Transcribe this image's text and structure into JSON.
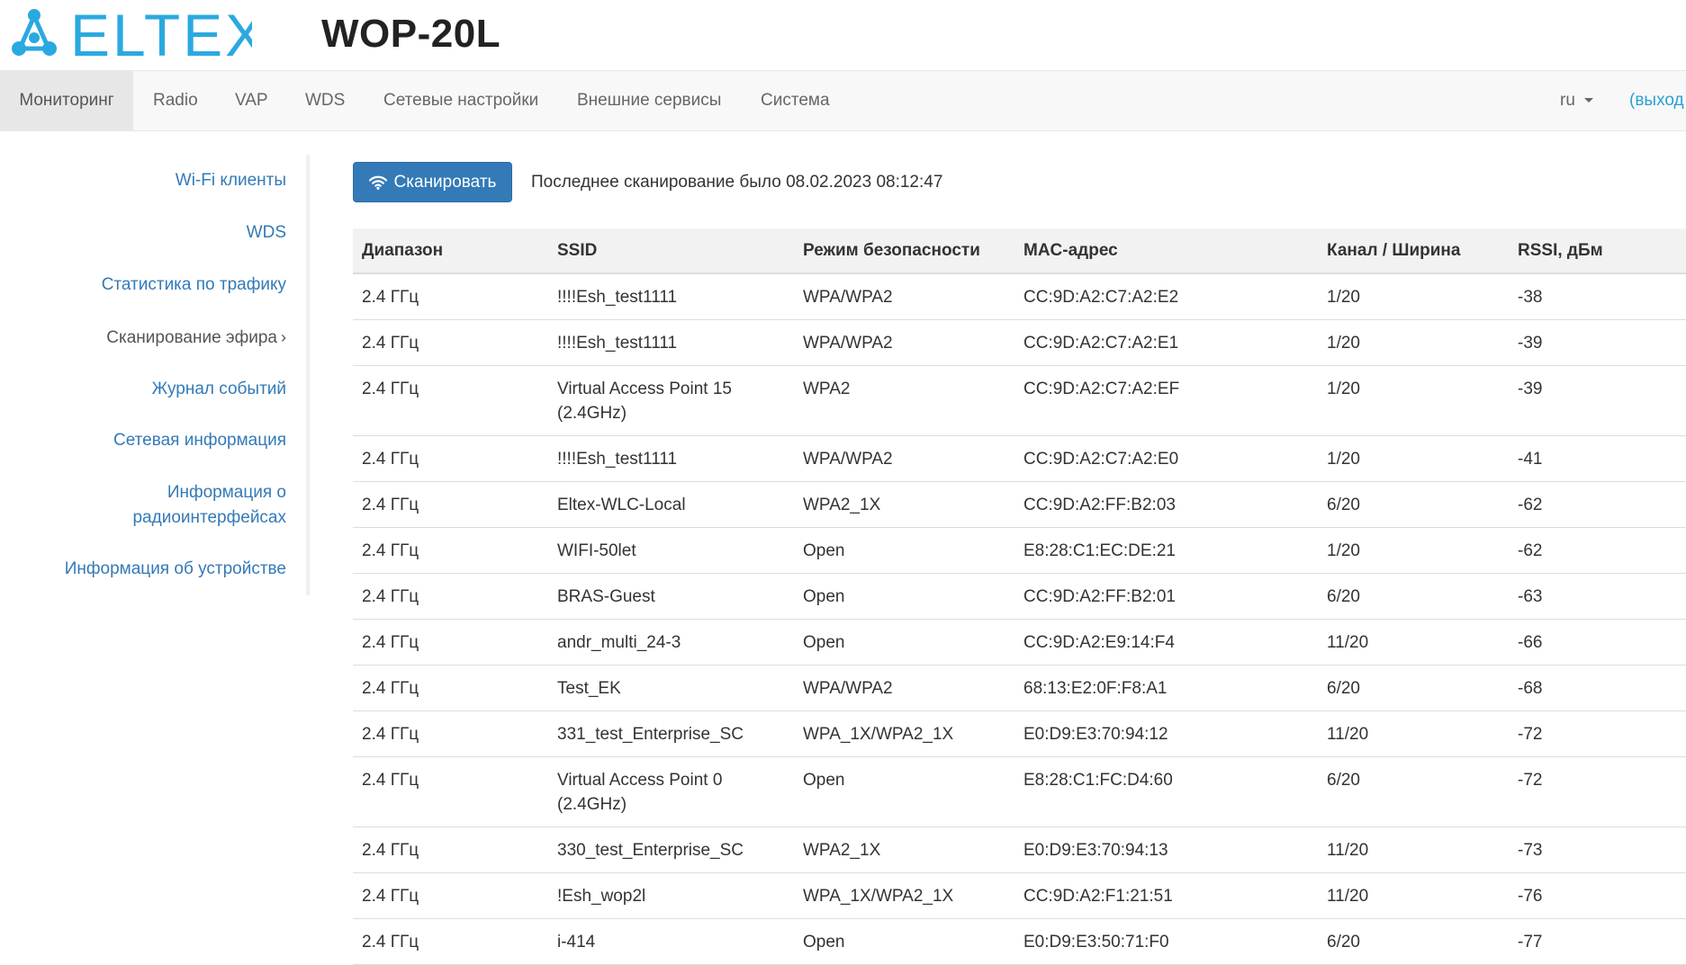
{
  "header": {
    "brand": "ELTEX",
    "model": "WOP-20L"
  },
  "nav": {
    "items": [
      {
        "label": "Мониторинг",
        "active": true
      },
      {
        "label": "Radio"
      },
      {
        "label": "VAP"
      },
      {
        "label": "WDS"
      },
      {
        "label": "Сетевые настройки"
      },
      {
        "label": "Внешние сервисы"
      },
      {
        "label": "Система"
      }
    ],
    "language": "ru",
    "logout": "(выход"
  },
  "sidebar": {
    "items": [
      {
        "label": "Wi-Fi клиенты"
      },
      {
        "label": "WDS"
      },
      {
        "label": "Статистика по трафику"
      },
      {
        "label": "Сканирование эфира",
        "active": true,
        "chevron": "›"
      },
      {
        "label": "Журнал событий"
      },
      {
        "label": "Сетевая информация"
      },
      {
        "label": "Информация о радиоинтерфейсах",
        "line1": "Информация о",
        "line2": "радиоинтерфейсах"
      },
      {
        "label": "Информация об устройстве"
      }
    ]
  },
  "scan": {
    "button_label": "Сканировать",
    "button_icon": "wifi-icon",
    "last_scan_text": "Последнее сканирование было 08.02.2023 08:12:47"
  },
  "table": {
    "columns": [
      "Диапазон",
      "SSID",
      "Режим безопасности",
      "MAC-адрес",
      "Канал / Ширина",
      "RSSI, дБм"
    ],
    "rows": [
      [
        "2.4 ГГц",
        "!!!!Esh_test1111",
        "WPA/WPA2",
        "CC:9D:A2:C7:A2:E2",
        "1/20",
        "-38"
      ],
      [
        "2.4 ГГц",
        "!!!!Esh_test1111",
        "WPA/WPA2",
        "CC:9D:A2:C7:A2:E1",
        "1/20",
        "-39"
      ],
      [
        "2.4 ГГц",
        "Virtual Access Point 15 (2.4GHz)",
        "WPA2",
        "CC:9D:A2:C7:A2:EF",
        "1/20",
        "-39"
      ],
      [
        "2.4 ГГц",
        "!!!!Esh_test1111",
        "WPA/WPA2",
        "CC:9D:A2:C7:A2:E0",
        "1/20",
        "-41"
      ],
      [
        "2.4 ГГц",
        "Eltex-WLC-Local",
        "WPA2_1X",
        "CC:9D:A2:FF:B2:03",
        "6/20",
        "-62"
      ],
      [
        "2.4 ГГц",
        "WIFI-50let",
        "Open",
        "E8:28:C1:EC:DE:21",
        "1/20",
        "-62"
      ],
      [
        "2.4 ГГц",
        "BRAS-Guest",
        "Open",
        "CC:9D:A2:FF:B2:01",
        "6/20",
        "-63"
      ],
      [
        "2.4 ГГц",
        "andr_multi_24-3",
        "Open",
        "CC:9D:A2:E9:14:F4",
        "11/20",
        "-66"
      ],
      [
        "2.4 ГГц",
        "Test_EK",
        "WPA/WPA2",
        "68:13:E2:0F:F8:A1",
        "6/20",
        "-68"
      ],
      [
        "2.4 ГГц",
        "331_test_Enterprise_SC",
        "WPA_1X/WPA2_1X",
        "E0:D9:E3:70:94:12",
        "11/20",
        "-72"
      ],
      [
        "2.4 ГГц",
        "Virtual Access Point 0 (2.4GHz)",
        "Open",
        "E8:28:C1:FC:D4:60",
        "6/20",
        "-72"
      ],
      [
        "2.4 ГГц",
        "330_test_Enterprise_SC",
        "WPA2_1X",
        "E0:D9:E3:70:94:13",
        "11/20",
        "-73"
      ],
      [
        "2.4 ГГц",
        "!Esh_wop2l",
        "WPA_1X/WPA2_1X",
        "CC:9D:A2:F1:21:51",
        "11/20",
        "-76"
      ],
      [
        "2.4 ГГц",
        "i-414",
        "Open",
        "E0:D9:E3:50:71:F0",
        "6/20",
        "-77"
      ]
    ]
  },
  "colors": {
    "brand": "#2aa9e0",
    "primary_button": "#337ab7",
    "link": "#337ab7",
    "logout_link": "#2a9fd6"
  }
}
